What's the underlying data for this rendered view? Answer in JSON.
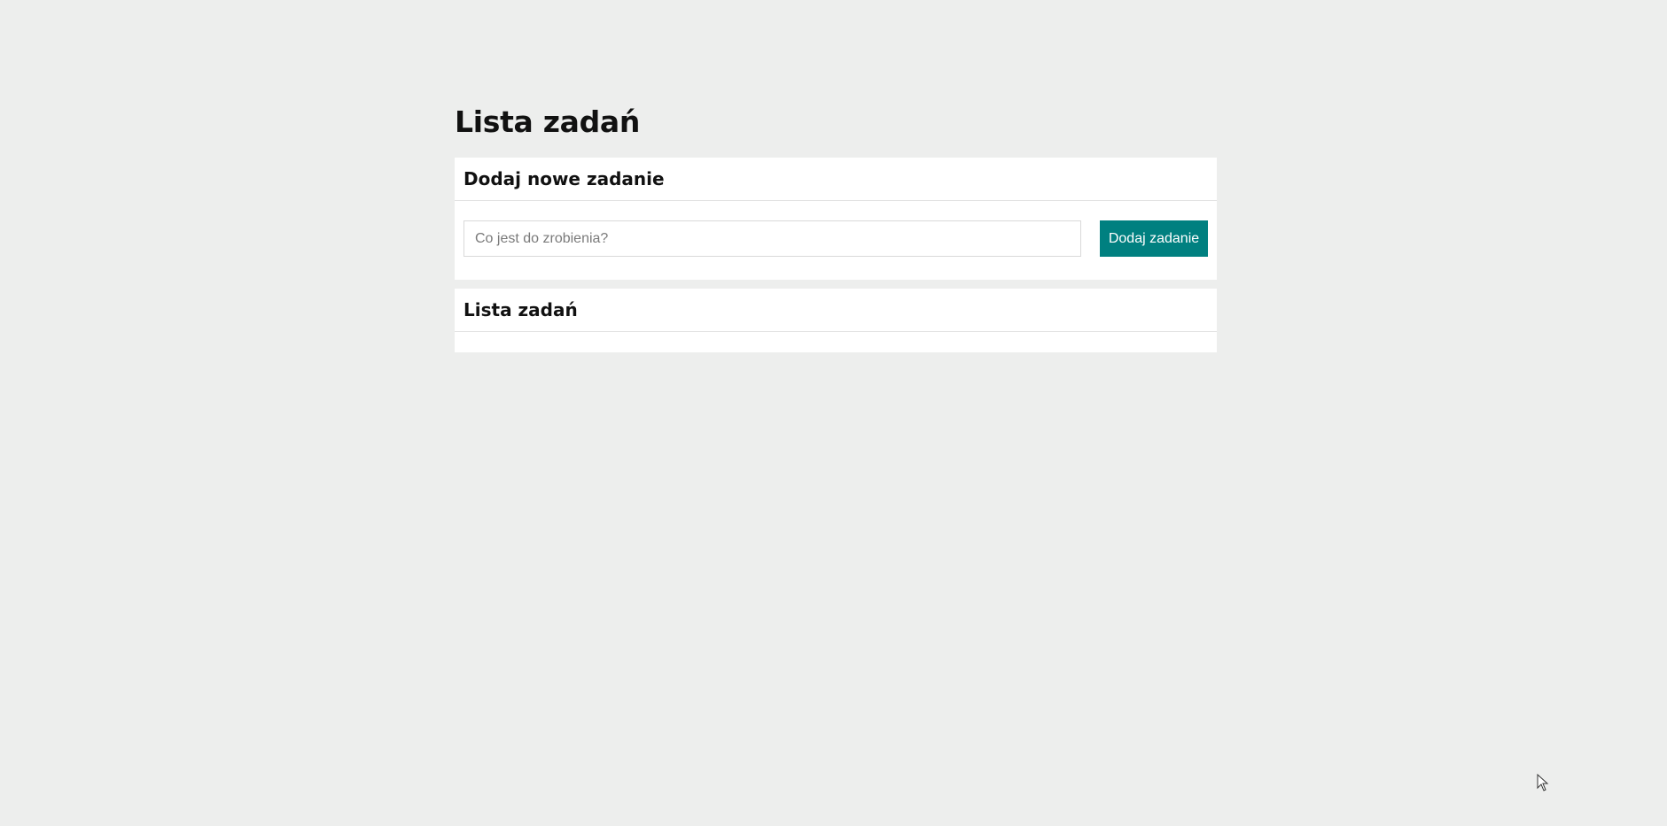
{
  "page": {
    "title": "Lista zadań"
  },
  "add_card": {
    "title": "Dodaj nowe zadanie",
    "input_value": "",
    "input_placeholder": "Co jest do zrobienia?",
    "button_label": "Dodaj zadanie"
  },
  "list_card": {
    "title": "Lista zadań",
    "items": []
  },
  "colors": {
    "background": "#edeeed",
    "card": "#ffffff",
    "accent": "#008080"
  },
  "icons": {
    "cursor": "arrow-pointer-icon"
  }
}
